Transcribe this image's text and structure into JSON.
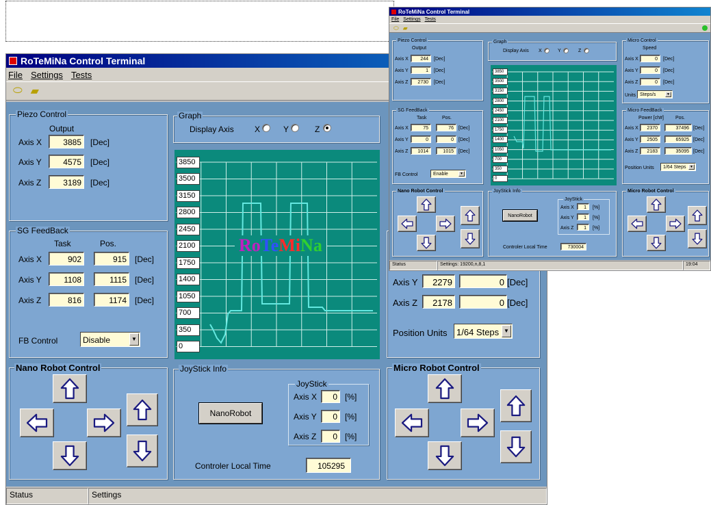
{
  "main": {
    "title": "RoTeMiNa Control Terminal",
    "menu": [
      "File",
      "Settings",
      "Tests"
    ],
    "piezo": {
      "legend": "Piezo Control",
      "output_label": "Output",
      "rows": [
        {
          "label": "Axis X",
          "value": "3885",
          "unit": "[Dec]"
        },
        {
          "label": "Axis Y",
          "value": "4575",
          "unit": "[Dec]"
        },
        {
          "label": "Axis Z",
          "value": "3189",
          "unit": "[Dec]"
        }
      ]
    },
    "sg": {
      "legend": "SG FeedBack",
      "task_label": "Task",
      "pos_label": "Pos.",
      "rows": [
        {
          "label": "Axis X",
          "task": "902",
          "pos": "915",
          "unit": "[Dec]"
        },
        {
          "label": "Axis Y",
          "task": "1108",
          "pos": "1115",
          "unit": "[Dec]"
        },
        {
          "label": "Axis Z",
          "task": "816",
          "pos": "1174",
          "unit": "[Dec]"
        }
      ],
      "fb_label": "FB Control",
      "fb_value": "Disable"
    },
    "graph": {
      "legend": "Graph",
      "display_axis_label": "Display Axis",
      "axes": [
        "X",
        "Y",
        "Z"
      ],
      "selected_axis": "Z",
      "ticks": [
        "3850",
        "3500",
        "3150",
        "2800",
        "2450",
        "2100",
        "1750",
        "1400",
        "1050",
        "700",
        "350",
        "0"
      ],
      "logo": [
        "Ro",
        "Te",
        "Mi",
        "Na"
      ],
      "logo_colors": [
        "#c020c0",
        "#2040ff",
        "#ff2020",
        "#20c020"
      ]
    },
    "nano": {
      "legend": "Nano Robot Control"
    },
    "joystick": {
      "legend": "JoyStick Info",
      "button": "NanoRobot",
      "inner_legend": "JoyStick",
      "rows": [
        {
          "label": "Axis X",
          "value": "0",
          "unit": "[%]"
        },
        {
          "label": "Axis Y",
          "value": "0",
          "unit": "[%]"
        },
        {
          "label": "Axis Z",
          "value": "0",
          "unit": "[%]"
        }
      ],
      "time_label": "Controler Local Time",
      "time_value": "105295"
    },
    "micro_feedback": {
      "rows": [
        {
          "label": "Axis Y",
          "power": "2279",
          "pos": "0",
          "unit": "[Dec]"
        },
        {
          "label": "Axis Z",
          "power": "2178",
          "pos": "0",
          "unit": "[Dec]"
        }
      ],
      "units_label": "Position Units",
      "units_value": "1/64 Steps"
    },
    "micro": {
      "legend": "Micro Robot Control"
    },
    "status": [
      "Status",
      "Settings"
    ]
  },
  "mini": {
    "title": "RoTeMiNa Control Terminal",
    "menu": [
      "File",
      "Settings",
      "Tests"
    ],
    "piezo": {
      "legend": "Piezo Control",
      "output_label": "Output",
      "rows": [
        {
          "label": "Axis X",
          "value": "244",
          "unit": "[Dec]"
        },
        {
          "label": "Axis Y",
          "value": "1",
          "unit": "[Dec]"
        },
        {
          "label": "Axis Z",
          "value": "2730",
          "unit": "[Dec]"
        }
      ]
    },
    "sg": {
      "legend": "SG FeedBack",
      "task_label": "Task",
      "pos_label": "Pos.",
      "rows": [
        {
          "label": "Axis X",
          "task": "75",
          "pos": "76",
          "unit": "[Dec]"
        },
        {
          "label": "Axis Y",
          "task": "0",
          "pos": "0",
          "unit": "[Dec]"
        },
        {
          "label": "Axis Z",
          "task": "1014",
          "pos": "1015",
          "unit": "[Dec]"
        }
      ],
      "fb_label": "FB Control",
      "fb_value": "Enable"
    },
    "graph": {
      "legend": "Graph",
      "display_axis_label": "Display Axis",
      "axes": [
        "X",
        "Y",
        "Z"
      ],
      "ticks": [
        "3850",
        "3500",
        "3150",
        "2800",
        "2450",
        "2100",
        "1750",
        "1400",
        "1050",
        "700",
        "350",
        "0"
      ]
    },
    "micro_ctl": {
      "legend": "Micro Control",
      "speed_label": "Speed",
      "rows": [
        {
          "label": "Axis X",
          "value": "0",
          "unit": "[Dec]"
        },
        {
          "label": "Axis Y",
          "value": "0",
          "unit": "[Dec]"
        },
        {
          "label": "Axis Z",
          "value": "0",
          "unit": "[Dec]"
        }
      ],
      "units_label": "Units",
      "units_value": "Steps/s"
    },
    "micro_fb": {
      "legend": "Micro FeedBack",
      "power_label": "Power [ch#]",
      "pos_label": "Pos.",
      "rows": [
        {
          "label": "Axis X",
          "power": "2370",
          "pos": "37496",
          "unit": "[Dec]"
        },
        {
          "label": "Axis Y",
          "power": "2505",
          "pos": "65925",
          "unit": "[Dec]"
        },
        {
          "label": "Axis Z",
          "power": "2183",
          "pos": "35095",
          "unit": "[Dec]"
        }
      ],
      "units_label": "Position Units",
      "units_value": "1/64 Steps"
    },
    "nano": {
      "legend": "Nano Robot Control"
    },
    "joystick": {
      "legend": "JoyStick Info",
      "button": "NanoRobot",
      "inner_legend": "JoyStick",
      "rows": [
        {
          "label": "Axis X",
          "value": "1",
          "unit": "[%]"
        },
        {
          "label": "Axis Y",
          "value": "1",
          "unit": "[%]"
        },
        {
          "label": "Axis Z",
          "value": "1",
          "unit": "[%]"
        }
      ],
      "time_label": "Controler Local Time",
      "time_value": "730004"
    },
    "micro": {
      "legend": "Micro Robot Control"
    },
    "status": [
      "Status",
      "Settings: 19200,n,8,1",
      "19:04"
    ]
  }
}
